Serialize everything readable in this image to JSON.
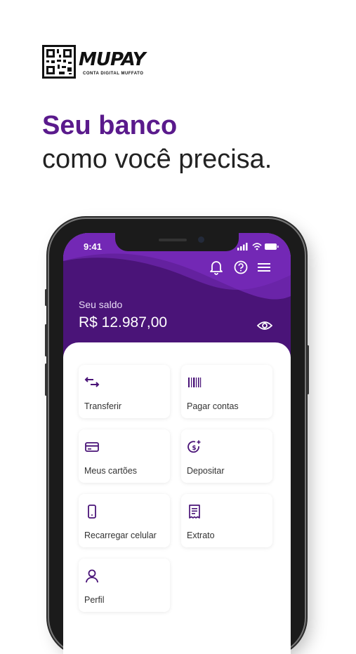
{
  "logo": {
    "brand": "MUPAY",
    "tagline": "CONTA DIGITAL MUFFATO"
  },
  "headline": {
    "bold": "Seu banco",
    "regular": "como você precisa."
  },
  "phone": {
    "status_time": "9:41",
    "balance": {
      "label": "Seu saldo",
      "value": "R$ 12.987,00"
    },
    "top_icons": [
      "bell-icon",
      "help-icon",
      "menu-icon"
    ],
    "menu": [
      {
        "label": "Transferir",
        "icon": "transfer-icon"
      },
      {
        "label": "Pagar contas",
        "icon": "barcode-icon"
      },
      {
        "label": "Meus cartões",
        "icon": "card-icon"
      },
      {
        "label": "Depositar",
        "icon": "deposit-icon"
      },
      {
        "label": "Recarregar celular",
        "icon": "phone-icon"
      },
      {
        "label": "Extrato",
        "icon": "receipt-icon"
      },
      {
        "label": "Perfil",
        "icon": "user-icon"
      }
    ]
  },
  "colors": {
    "brand_purple": "#5a1a8c",
    "header_dark": "#4a1478",
    "header_wave": "#6a24a8",
    "icon_purple": "#4a1478"
  }
}
